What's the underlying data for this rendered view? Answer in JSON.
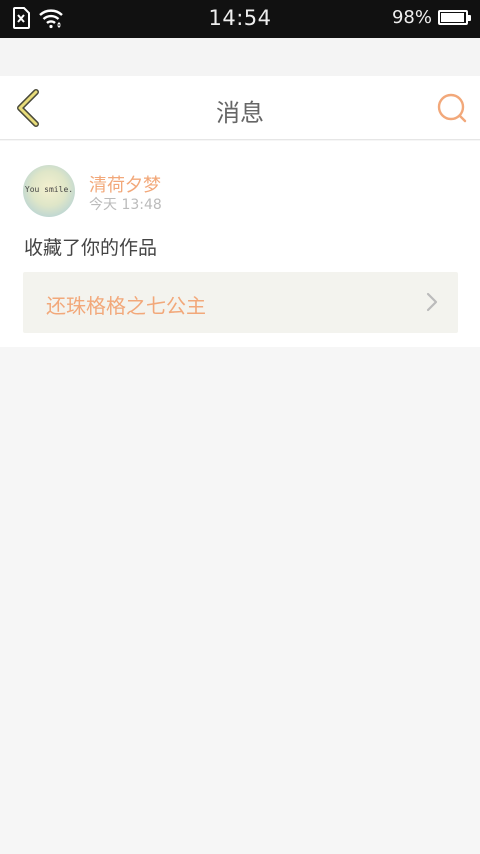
{
  "status_bar": {
    "time": "14:54",
    "battery_text": "98%",
    "battery_level": 0.98,
    "icons": [
      "sim-error-icon",
      "wifi-icon",
      "battery-icon"
    ]
  },
  "header": {
    "title": "消息",
    "back_icon": "back-chevron-icon",
    "search_icon": "search-icon"
  },
  "message": {
    "avatar_text": "You smile.",
    "user_name": "清荷夕梦",
    "time": "今天  13:48",
    "action": "收藏了你的作品",
    "work_title": "还珠格格之七公主"
  },
  "colors": {
    "accent": "#f2a87a",
    "back_icon": "#c8b24a"
  }
}
